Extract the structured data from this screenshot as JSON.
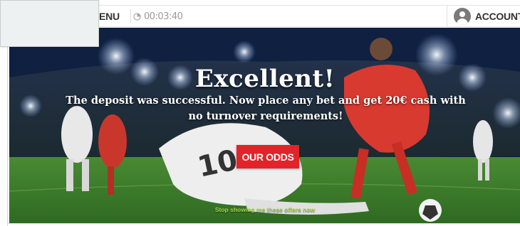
{
  "topbar": {
    "menu_label": "ENU",
    "timer": "00:03:40",
    "account_label": "ACCOUNT"
  },
  "promo": {
    "headline": "Excellent!",
    "message": "The deposit was successful. Now place any bet and get 20€ cash with no turnover requirements!",
    "cta_label": "OUR ODDS",
    "dismiss_label": "Stop showing me these offers now"
  },
  "icons": {
    "timer": "clock-icon",
    "account": "user-avatar-icon"
  },
  "colors": {
    "cta": "#e2232a",
    "dismiss": "#a8d84a",
    "topbar_text": "#333333",
    "timer_text": "#9a9a9a"
  }
}
